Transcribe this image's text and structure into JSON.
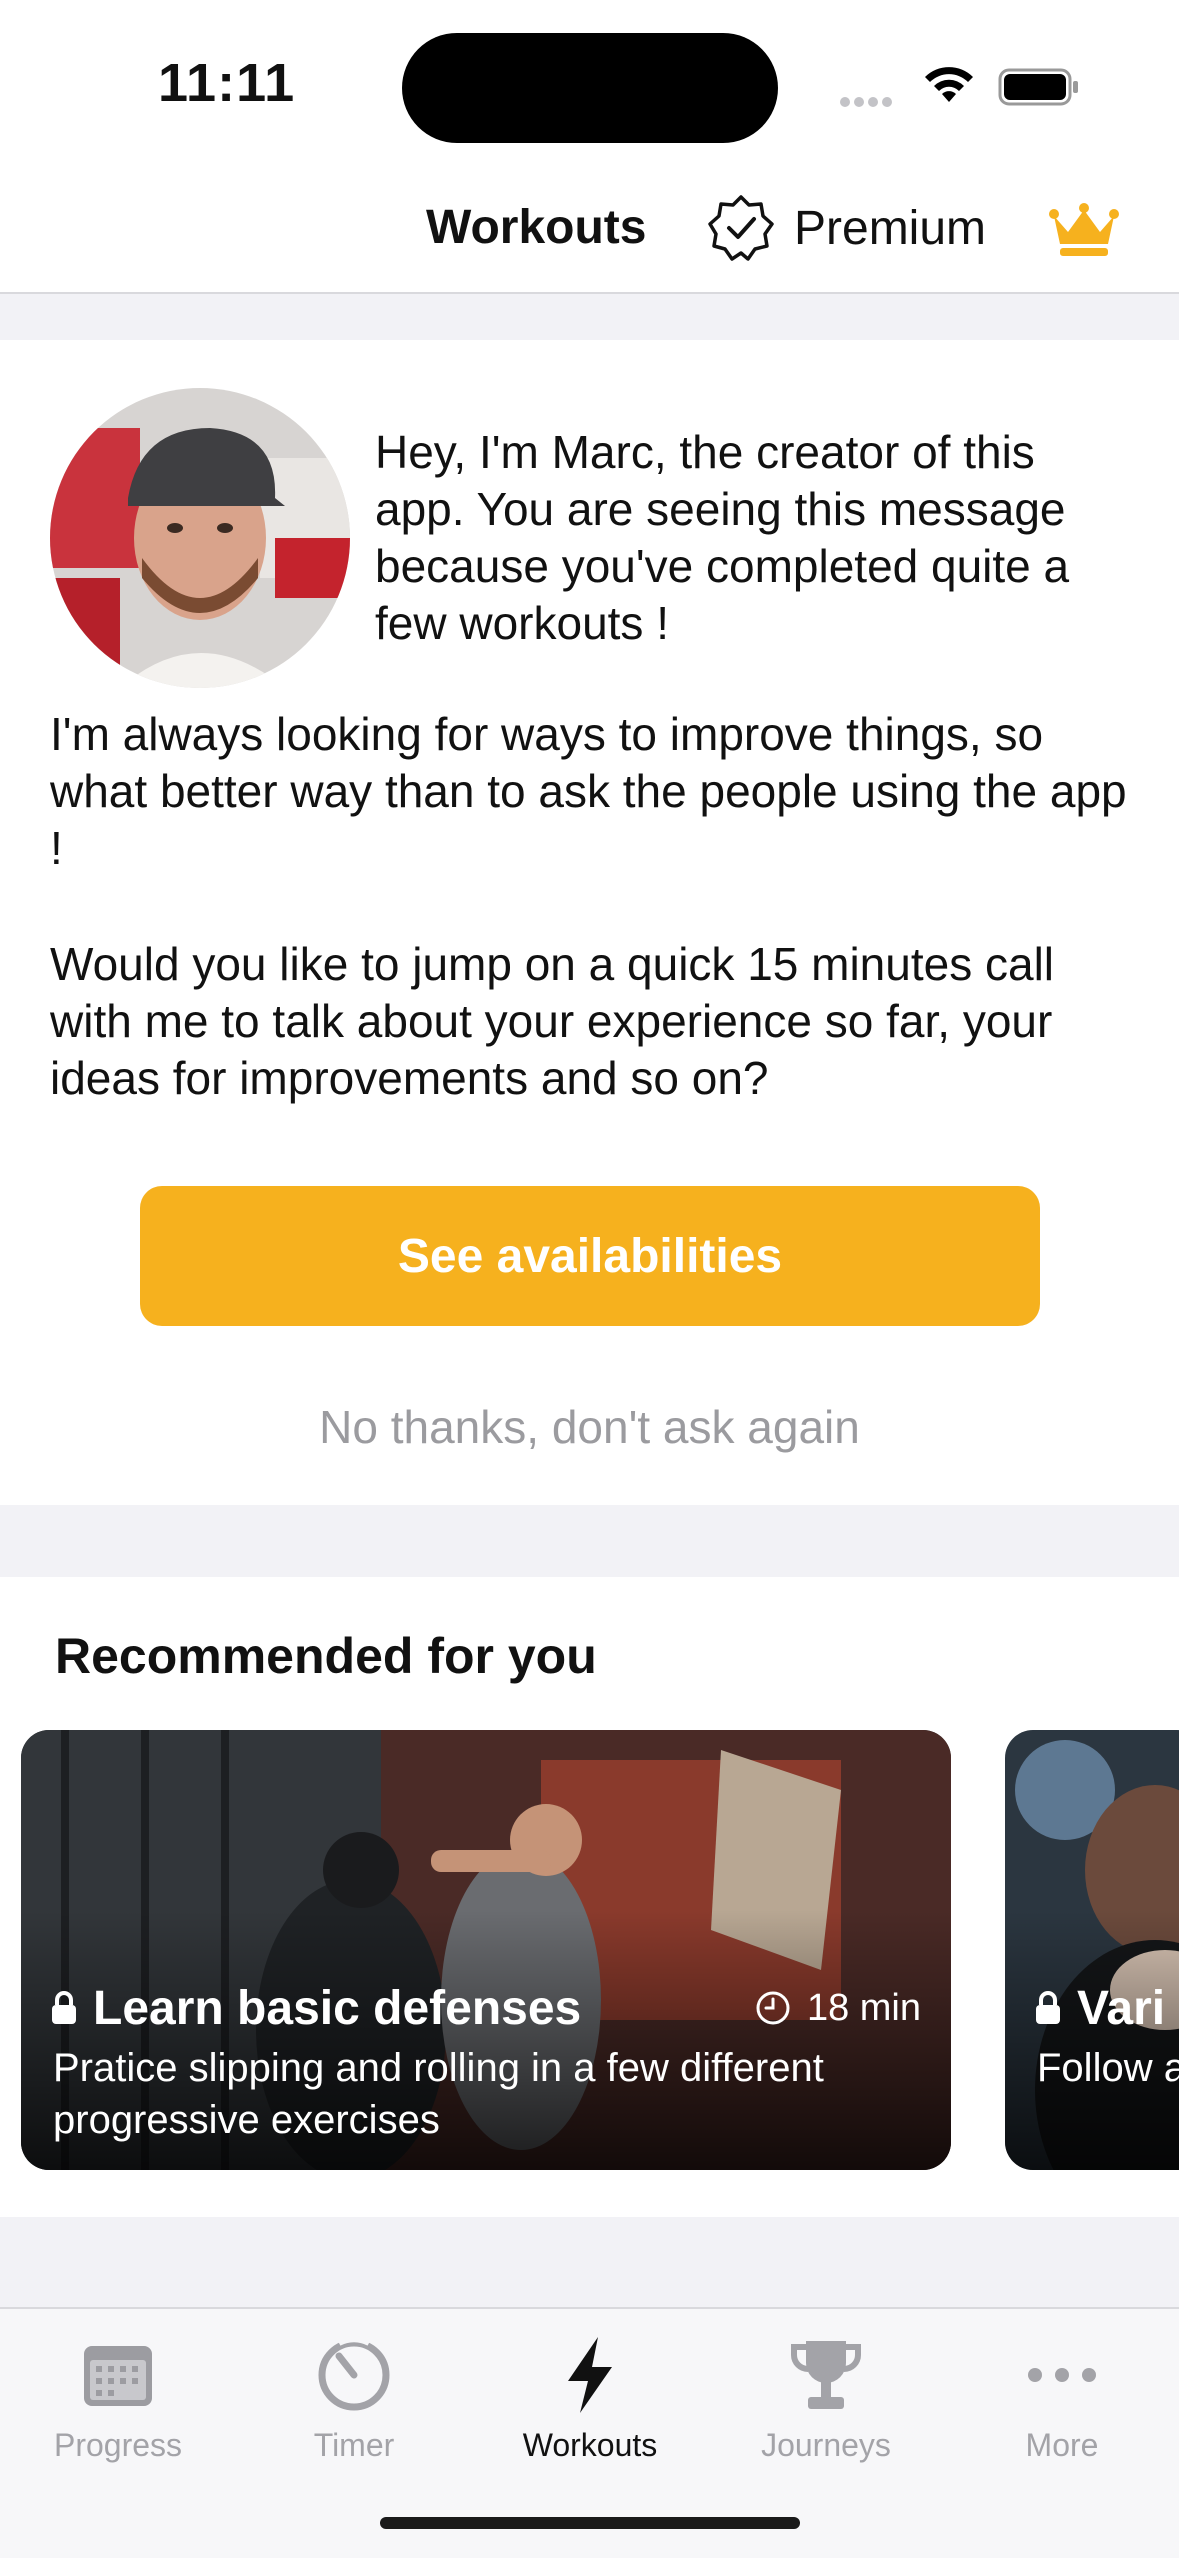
{
  "status": {
    "time": "11:11"
  },
  "header": {
    "title": "Workouts",
    "premium_label": "Premium"
  },
  "message": {
    "intro": "Hey, I'm Marc, the creator of this app. You are seeing this message because you've completed quite a few workouts !",
    "paragraph1": "I'm always looking for ways to improve things, so what better way than to ask the people using the app !",
    "paragraph2": "Would you like to jump on a quick 15 minutes call with me to talk about your experience so far, your ideas for improvements and so on?",
    "cta_label": "See availabilities",
    "decline_label": "No thanks, don't ask again"
  },
  "recommended": {
    "title": "Recommended for you",
    "cards": [
      {
        "title": "Learn basic defenses",
        "duration": "18 min",
        "description": "Pratice slipping and rolling in a few different progressive exercises",
        "locked": true
      },
      {
        "title": "Vari",
        "description": "Follow a",
        "locked": true
      }
    ]
  },
  "tabbar": {
    "tabs": [
      {
        "label": "Progress",
        "icon": "calendar-icon"
      },
      {
        "label": "Timer",
        "icon": "timer-icon"
      },
      {
        "label": "Workouts",
        "icon": "lightning-icon",
        "active": true
      },
      {
        "label": "Journeys",
        "icon": "trophy-icon"
      },
      {
        "label": "More",
        "icon": "more-dots-icon"
      }
    ]
  },
  "colors": {
    "accent": "#f6b11e",
    "text": "#111111",
    "muted": "#9b9b9f",
    "background": "#f2f2f6"
  }
}
